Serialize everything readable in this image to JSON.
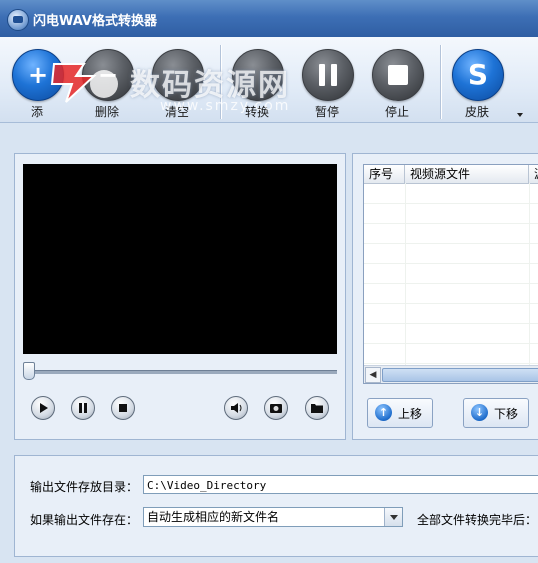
{
  "window": {
    "title": "闪电WAV格式转换器"
  },
  "toolbar": {
    "add_label": "添",
    "delete_label": "删除",
    "clear_label": "清空",
    "convert_label": "转换",
    "pause_label": "暂停",
    "stop_label": "停止",
    "skin_label": "皮肤",
    "skin_glyph": "S",
    "add_glyph": "+",
    "delete_glyph": "−"
  },
  "watermark": {
    "text": "数码资源网",
    "sub": "www.smzy.com"
  },
  "player": {
    "progress": 0.0
  },
  "file_list": {
    "columns": [
      "序号",
      "视频源文件",
      "源"
    ],
    "rows": []
  },
  "list_buttons": {
    "up_label": "上移",
    "down_label": "下移"
  },
  "settings": {
    "output_dir_label": "输出文件存放目录：",
    "output_dir_value": "C:\\Video_Directory",
    "exists_label": "如果输出文件存在：",
    "exists_option": "自动生成相应的新文件名",
    "after_all_label": "全部文件转换完毕后："
  },
  "colors": {
    "titlebar": "#3d6fb5",
    "panel": "#e8eff8",
    "accent_blue": "#1e73d6"
  }
}
